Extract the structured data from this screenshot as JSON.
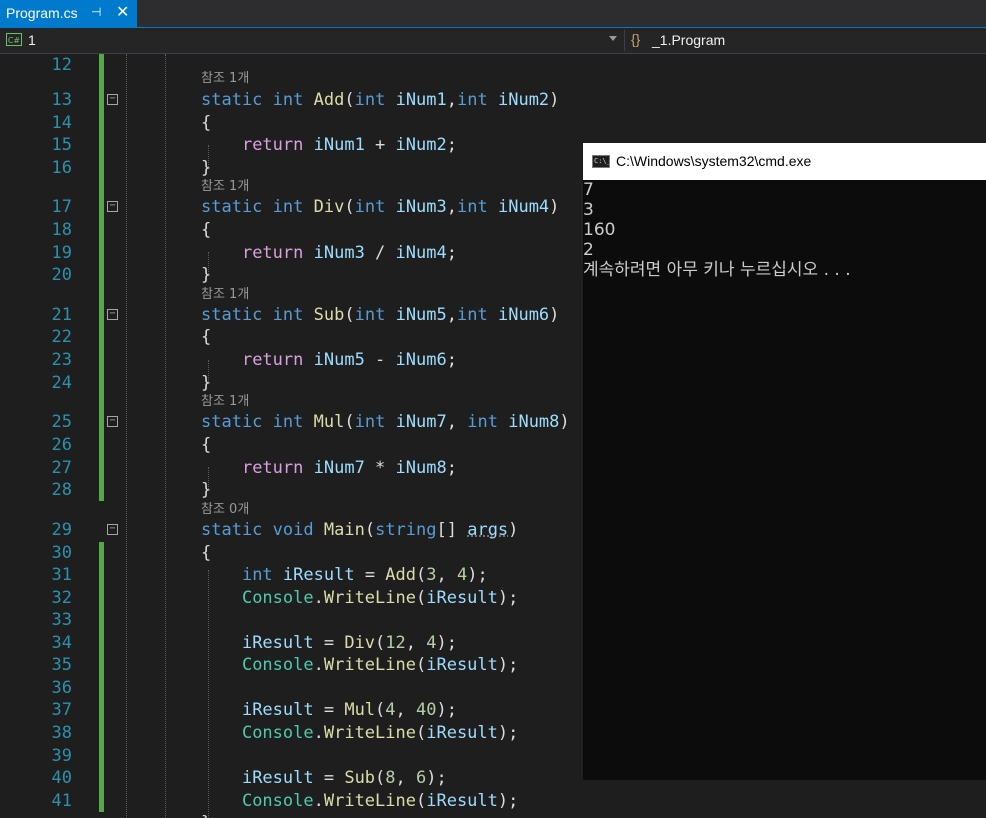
{
  "tab": {
    "title": "Program.cs",
    "pin": "⊣",
    "close": "✕"
  },
  "navbar": {
    "project": "1",
    "project_icon": "C#",
    "class": "_1.Program",
    "class_icon": "{}"
  },
  "editor": {
    "lines": [
      {
        "n": "12"
      },
      {
        "n": "13"
      },
      {
        "n": "14"
      },
      {
        "n": "15"
      },
      {
        "n": "16"
      },
      {
        "n": "17"
      },
      {
        "n": "18"
      },
      {
        "n": "19"
      },
      {
        "n": "20"
      },
      {
        "n": "21"
      },
      {
        "n": "22"
      },
      {
        "n": "23"
      },
      {
        "n": "24"
      },
      {
        "n": "25"
      },
      {
        "n": "26"
      },
      {
        "n": "27"
      },
      {
        "n": "28"
      },
      {
        "n": "29"
      },
      {
        "n": "30"
      },
      {
        "n": "31"
      },
      {
        "n": "32"
      },
      {
        "n": "33"
      },
      {
        "n": "34"
      },
      {
        "n": "35"
      },
      {
        "n": "36"
      },
      {
        "n": "37"
      },
      {
        "n": "38"
      },
      {
        "n": "39"
      },
      {
        "n": "40"
      },
      {
        "n": "41"
      }
    ],
    "refs": {
      "add": "참조 1개",
      "div": "참조 1개",
      "sub": "참조 1개",
      "mul": "참조 1개",
      "main": "참조 0개"
    },
    "tokens": {
      "static": "static",
      "int": "int",
      "void": "void",
      "string": "string",
      "return": "return",
      "Add": "Add",
      "Div": "Div",
      "Sub": "Sub",
      "Mul": "Mul",
      "Main": "Main",
      "Console": "Console",
      "WriteLine": "WriteLine",
      "iNum1": "iNum1",
      "iNum2": "iNum2",
      "iNum3": "iNum3",
      "iNum4": "iNum4",
      "iNum5": "iNum5",
      "iNum6": "iNum6",
      "iNum7": "iNum7",
      "iNum8": "iNum8",
      "iResult": "iResult",
      "args": "args",
      "n3": "3",
      "n4": "4",
      "n12": "12",
      "n40": "40",
      "n8": "8",
      "n6": "6",
      "lbrace": "{",
      "rbrace": "}"
    }
  },
  "console": {
    "title": "C:\\Windows\\system32\\cmd.exe",
    "icon": "C:\\_",
    "output": [
      "7",
      "3",
      "160",
      "2",
      "계속하려면 아무 키나 누르십시오 . . ."
    ]
  }
}
